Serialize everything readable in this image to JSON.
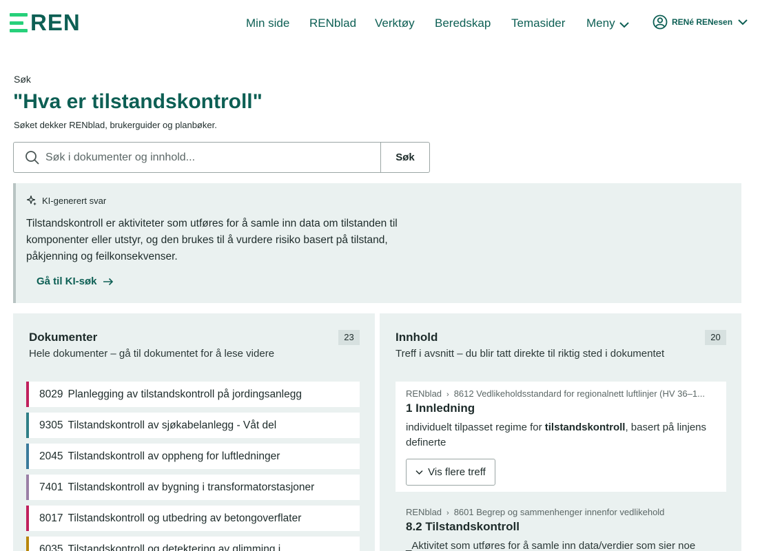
{
  "brand": {
    "logo_text": "REN",
    "accent": "#27d07a",
    "primary": "#0d5f54"
  },
  "nav": {
    "items": [
      {
        "label": "Min side"
      },
      {
        "label": "RENblad"
      },
      {
        "label": "Verktøy"
      },
      {
        "label": "Beredskap"
      },
      {
        "label": "Temasider"
      },
      {
        "label": "Meny",
        "icon": "chevron-down-icon"
      }
    ],
    "user_name": "RENé RENesen"
  },
  "search": {
    "breadcrumb": "Søk",
    "title": "\"Hva er tilstandskontroll\"",
    "subtitle": "Søket dekker RENblad, brukerguider og planbøker.",
    "placeholder": "Søk i dokumenter og innhold...",
    "button_label": "Søk"
  },
  "ai_answer": {
    "tag": "KI-generert svar",
    "text": "Tilstandskontroll er aktiviteter som utføres for å samle inn data om tilstanden til komponenter eller utstyr, og den brukes til å vurdere risiko basert på tilstand, påkjenning og feilkonsekvenser.",
    "link_label": "Gå til KI-søk"
  },
  "documents": {
    "title": "Dokumenter",
    "subtitle": "Hele dokumenter – gå til dokumentet for å lese videre",
    "count": "23",
    "items": [
      {
        "number": "8029",
        "name": "Planlegging av tilstandskontroll på jordingsanlegg",
        "color": "#c0205c"
      },
      {
        "number": "9305",
        "name": "Tilstandskontroll av sjøkabelanlegg - Våt del",
        "color": "#2f7f86"
      },
      {
        "number": "2045",
        "name": "Tilstandskontroll av oppheng for luftledninger",
        "color": "#3a7a9b"
      },
      {
        "number": "7401",
        "name": "Tilstandskontroll av bygning i transformatorstasjoner",
        "color": "#9a7fa6"
      },
      {
        "number": "8017",
        "name": "Tilstandskontroll og utbedring av betongoverflater",
        "color": "#c0205c"
      },
      {
        "number": "6035",
        "name": "Tilstandskontroll og detektering av glimming i",
        "color": "#b8860b"
      }
    ]
  },
  "content": {
    "title": "Innhold",
    "subtitle": "Treff i avsnitt – du blir tatt direkte til riktig sted i dokumentet",
    "count": "20",
    "hits": [
      {
        "source": "RENblad",
        "document": "8612 Vedlikeholdsstandard for regionalnett luftlinjer (HV 36–1...",
        "heading": "1 Innledning",
        "snippet_before": "individuelt tilpasset regime for ",
        "snippet_highlight": "tilstandskontroll",
        "snippet_after": ", basert på linjens definerte",
        "more_label": "Vis flere treff"
      },
      {
        "source": "RENblad",
        "document": "8601 Begrep og sammenhenger innenfor vedlikehold",
        "heading": "8.2 Tilstandskontroll",
        "snippet": "_Aktivitet som utføres for å samle inn data/verdier som sier noe"
      }
    ]
  }
}
